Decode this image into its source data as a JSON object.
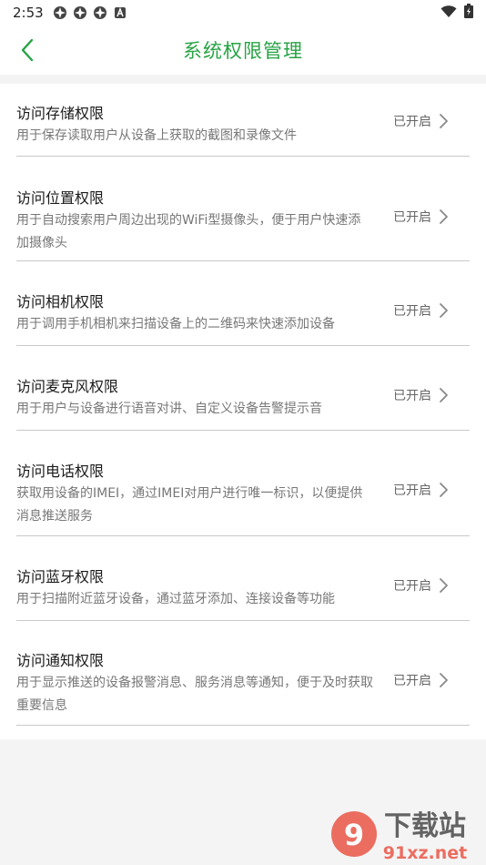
{
  "status_bar": {
    "time": "2:53",
    "notification_icons": [
      "app-notification-icon",
      "app-notification-icon",
      "app-notification-icon",
      "a-badge-icon"
    ],
    "right_icons": [
      "wifi-icon",
      "battery-charging-icon"
    ]
  },
  "header": {
    "title": "系统权限管理",
    "accent_color": "#27a344"
  },
  "permissions": [
    {
      "title": "访问存储权限",
      "description": "用于保存读取用户从设备上获取的截图和录像文件",
      "status": "已开启"
    },
    {
      "title": "访问位置权限",
      "description": "用于自动搜索用户周边出现的WiFi型摄像头，便于用户快速添加摄像头",
      "status": "已开启"
    },
    {
      "title": "访问相机权限",
      "description": "用于调用手机相机来扫描设备上的二维码来快速添加设备",
      "status": "已开启"
    },
    {
      "title": "访问麦克风权限",
      "description": "用于用户与设备进行语音对讲、自定义设备告警提示音",
      "status": "已开启"
    },
    {
      "title": "访问电话权限",
      "description": "获取用设备的IMEI，通过IMEI对用户进行唯一标识，以便提供消息推送服务",
      "status": "已开启"
    },
    {
      "title": "访问蓝牙权限",
      "description": "用于扫描附近蓝牙设备，通过蓝牙添加、连接设备等功能",
      "status": "已开启"
    },
    {
      "title": "访问通知权限",
      "description": "用于显示推送的设备报警消息、服务消息等通知，便于及时获取重要信息",
      "status": "已开启"
    }
  ],
  "watermark": {
    "name": "下载站",
    "url": "91xz.net"
  }
}
